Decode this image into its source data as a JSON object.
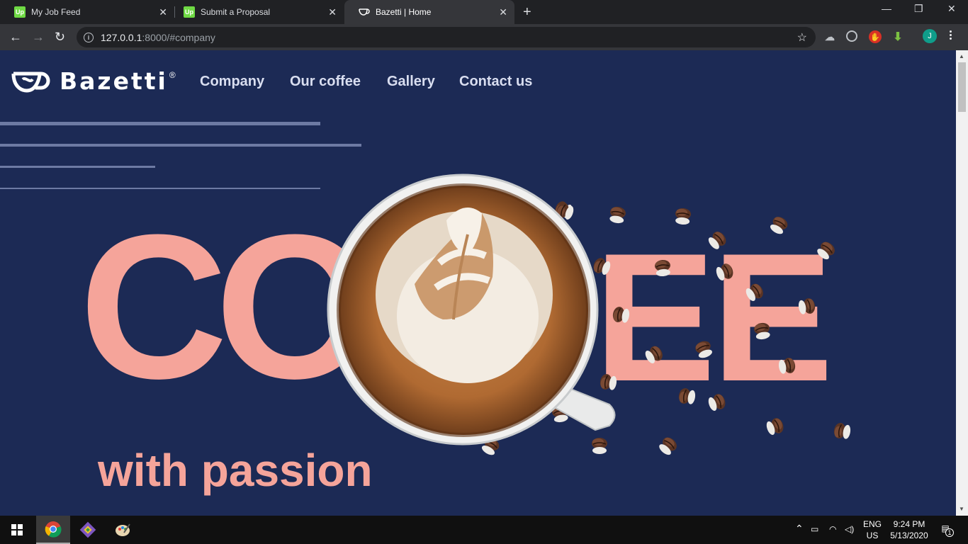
{
  "browser": {
    "tabs": [
      {
        "label": "My Job Feed",
        "favicon": "upwork-icon",
        "favicon_text": "Up",
        "active": false
      },
      {
        "label": "Submit a Proposal",
        "favicon": "upwork-icon",
        "favicon_text": "Up",
        "active": false
      },
      {
        "label": "Bazetti | Home",
        "favicon": "bazetti-cup-icon",
        "active": true
      }
    ],
    "url_host": "127.0.0.1",
    "url_rest": ":8000/#company",
    "avatar_initial": "J"
  },
  "site": {
    "brand": "Bazetti",
    "registered_mark": "®",
    "nav": [
      "Company",
      "Our coffee",
      "Gallery",
      "Contact us"
    ],
    "hero_word_left": "CO",
    "hero_word_right": "EE",
    "tagline": "with passion"
  },
  "taskbar": {
    "lang_top": "ENG",
    "lang_bottom": "US",
    "time": "9:24 PM",
    "date": "5/13/2020",
    "notification_count": "1"
  },
  "colors": {
    "page_bg": "#1c2a55",
    "accent_pink": "#f5a49a"
  }
}
